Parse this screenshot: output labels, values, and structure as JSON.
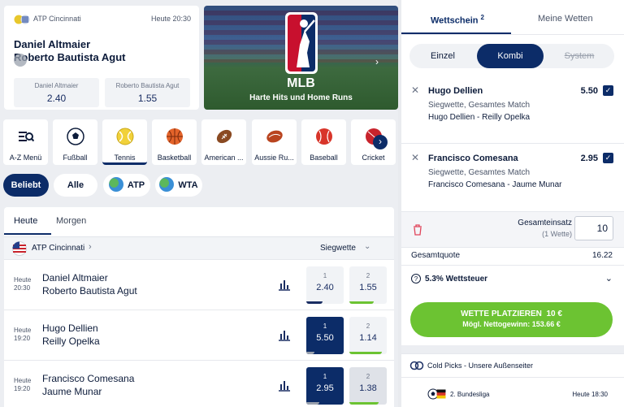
{
  "featured_match": {
    "tournament": "ATP Cincinnati",
    "time": "Heute 20:30",
    "team1": "Daniel Altmaier",
    "team2": "Roberto Bautista Agut",
    "odds": [
      {
        "label": "Daniel Altmaier",
        "value": "2.40"
      },
      {
        "label": "Roberto Bautista Agut",
        "value": "1.55"
      }
    ]
  },
  "banner": {
    "title": "MLB",
    "subtitle": "Harte Hits und Home Runs"
  },
  "sports": [
    {
      "label": "A-Z Menü",
      "icon": "list-search-icon"
    },
    {
      "label": "Fußball",
      "icon": "soccer-ball-icon"
    },
    {
      "label": "Tennis",
      "icon": "tennis-ball-icon"
    },
    {
      "label": "Basketball",
      "icon": "basketball-icon"
    },
    {
      "label": "American ...",
      "icon": "american-football-icon"
    },
    {
      "label": "Aussie Ru...",
      "icon": "aussie-rules-ball-icon"
    },
    {
      "label": "Baseball",
      "icon": "baseball-icon"
    },
    {
      "label": "Cricket",
      "icon": "cricket-ball-icon"
    }
  ],
  "filters": [
    "Beliebt",
    "Alle",
    "ATP",
    "WTA"
  ],
  "day_tabs": [
    "Heute",
    "Morgen"
  ],
  "section": {
    "tournament": "ATP Cincinnati",
    "market": "Siegwette"
  },
  "matches": [
    {
      "day": "Heute",
      "time": "20:30",
      "team1": "Daniel Altmaier",
      "team2": "Roberto Bautista Agut",
      "odds": [
        {
          "label": "1",
          "value": "2.40"
        },
        {
          "label": "2",
          "value": "1.55"
        }
      ]
    },
    {
      "day": "Heute",
      "time": "19:20",
      "team1": "Hugo Dellien",
      "team2": "Reilly Opelka",
      "odds": [
        {
          "label": "1",
          "value": "5.50"
        },
        {
          "label": "2",
          "value": "1.14"
        }
      ]
    },
    {
      "day": "Heute",
      "time": "19:20",
      "team1": "Francisco Comesana",
      "team2": "Jaume Munar",
      "odds": [
        {
          "label": "1",
          "value": "2.95"
        },
        {
          "label": "2",
          "value": "1.38"
        }
      ]
    }
  ],
  "betslip": {
    "tab_active": "Wettschein",
    "tab_count": "2",
    "tab_other": "Meine Wetten",
    "modes": [
      "Einzel",
      "Kombi",
      "System"
    ],
    "bets": [
      {
        "pick": "Hugo Dellien",
        "odd": "5.50",
        "market": "Siegwette, Gesamtes Match",
        "event": "Hugo Dellien - Reilly Opelka"
      },
      {
        "pick": "Francisco Comesana",
        "odd": "2.95",
        "market": "Siegwette, Gesamtes Match",
        "event": "Francisco Comesana - Jaume Munar"
      }
    ],
    "stake_label": "Gesamteinsatz",
    "stake_sub": "(1 Wette)",
    "stake_value": "10",
    "total_odds_label": "Gesamtquote",
    "total_odds": "16.22",
    "tax_label": "5.3% Wettsteuer",
    "place_label": "WETTE PLATZIEREN  10 €",
    "payout_label": "Mögl. Nettogewinn: 153.66 €"
  },
  "cold_picks": {
    "title": "Cold Picks - Unsere Außenseiter",
    "league": "2. Bundesliga",
    "time": "Heute 18:30"
  }
}
